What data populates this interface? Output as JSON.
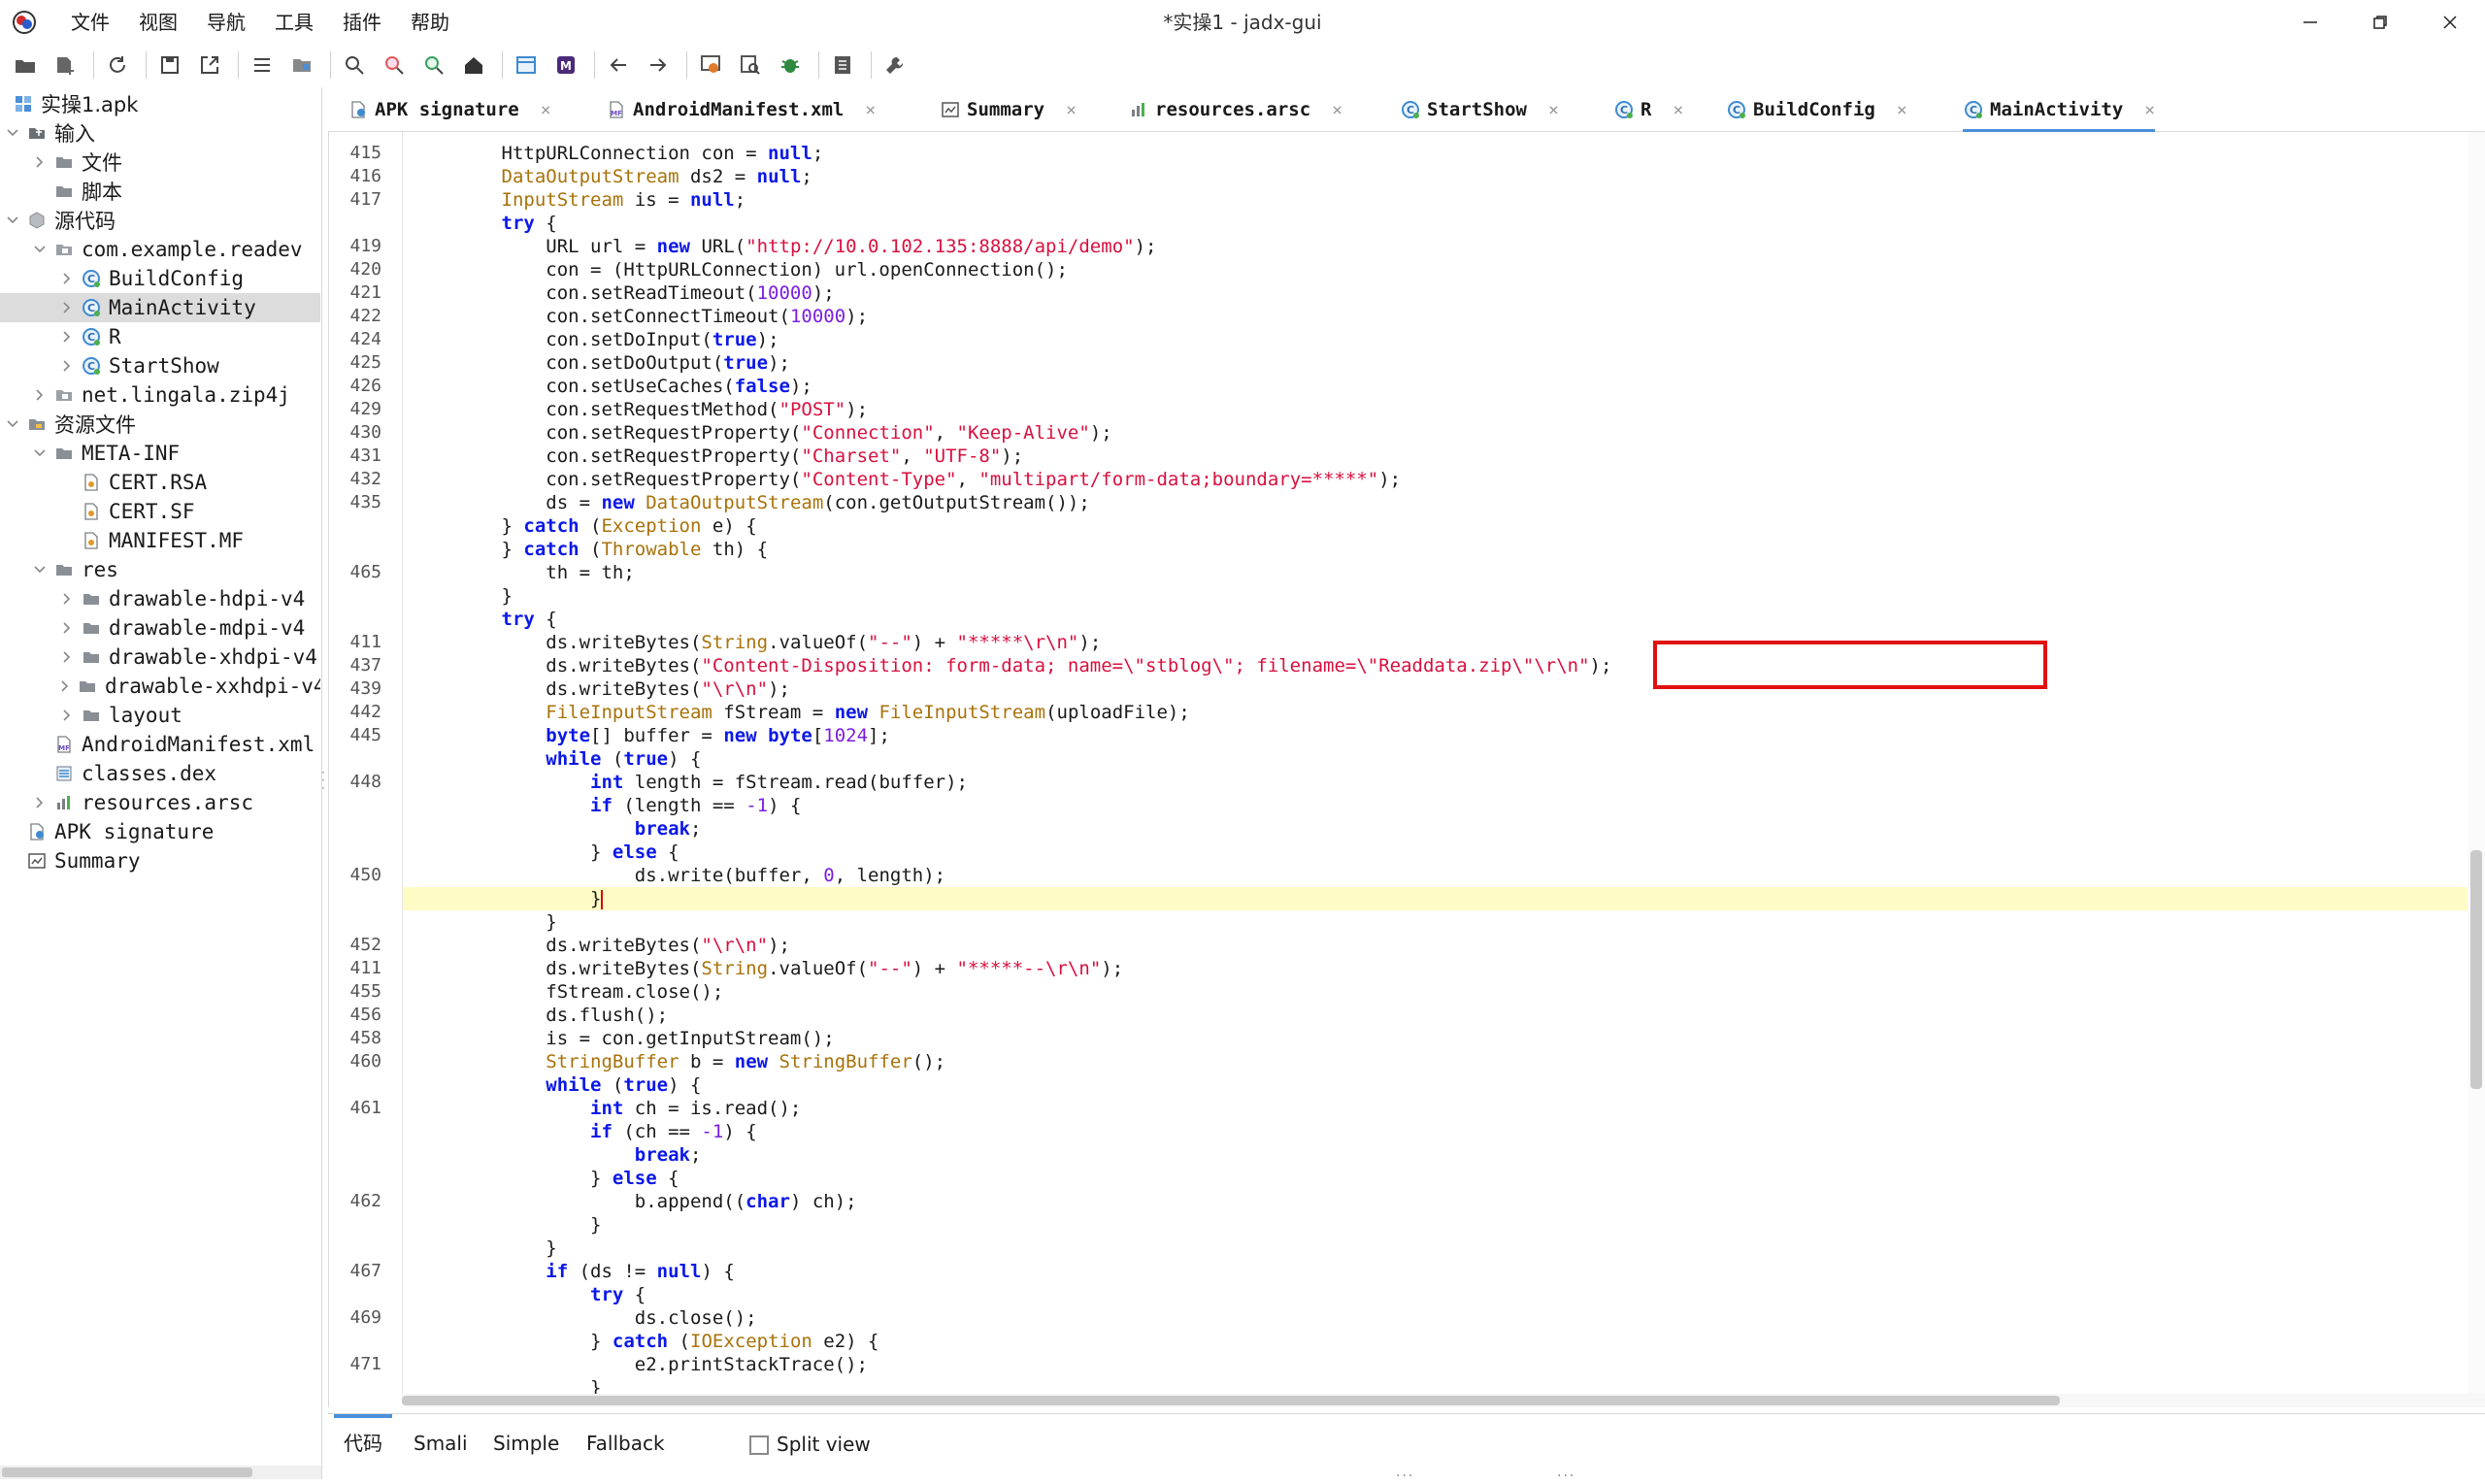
{
  "window": {
    "title": "*实操1 - jadx-gui"
  },
  "menu": [
    "文件",
    "视图",
    "导航",
    "工具",
    "插件",
    "帮助"
  ],
  "toolbar": [
    "open-file-icon",
    "add-files-icon",
    "reload-icon",
    "save-icon",
    "export-icon",
    "sync-icon",
    "flatten-icon",
    "search-icon",
    "find-usage-icon",
    "find-class-icon",
    "home-icon",
    "log-icon",
    "mcp-icon",
    "back-icon",
    "forward-icon",
    "deobfuscation-icon",
    "quark-icon",
    "debug-icon",
    "notes-icon",
    "preferences-icon"
  ],
  "tree": [
    {
      "label": "实操1.apk",
      "icon": "apk-icon",
      "arrow": "",
      "cn": true
    },
    {
      "label": "输入",
      "icon": "input-folder-icon",
      "arrow": "v",
      "cn": true
    },
    {
      "label": "文件",
      "icon": "folder-icon",
      "arrow": ">",
      "cn": true
    },
    {
      "label": "脚本",
      "icon": "folder-icon",
      "arrow": "",
      "cn": true
    },
    {
      "label": "源代码",
      "icon": "source-icon",
      "arrow": "v",
      "cn": true
    },
    {
      "label": "com.example.readev",
      "icon": "package-icon",
      "arrow": "v"
    },
    {
      "label": "BuildConfig",
      "icon": "class-icon",
      "arrow": ">"
    },
    {
      "label": "MainActivity",
      "icon": "class-icon",
      "arrow": ">",
      "selected": true
    },
    {
      "label": "R",
      "icon": "class-icon",
      "arrow": ">"
    },
    {
      "label": "StartShow",
      "icon": "class-icon",
      "arrow": ">"
    },
    {
      "label": "net.lingala.zip4j",
      "icon": "package-icon",
      "arrow": ">"
    },
    {
      "label": "资源文件",
      "icon": "resources-icon",
      "arrow": "v",
      "cn": true
    },
    {
      "label": "META-INF",
      "icon": "folder-icon",
      "arrow": "v"
    },
    {
      "label": "CERT.RSA",
      "icon": "file-icon",
      "arrow": ""
    },
    {
      "label": "CERT.SF",
      "icon": "file-icon",
      "arrow": ""
    },
    {
      "label": "MANIFEST.MF",
      "icon": "file-icon",
      "arrow": ""
    },
    {
      "label": "res",
      "icon": "folder-icon",
      "arrow": "v"
    },
    {
      "label": "drawable-hdpi-v4",
      "icon": "folder-icon",
      "arrow": ">"
    },
    {
      "label": "drawable-mdpi-v4",
      "icon": "folder-icon",
      "arrow": ">"
    },
    {
      "label": "drawable-xhdpi-v4",
      "icon": "folder-icon",
      "arrow": ">"
    },
    {
      "label": "drawable-xxhdpi-v4",
      "icon": "folder-icon",
      "arrow": ">"
    },
    {
      "label": "layout",
      "icon": "folder-icon",
      "arrow": ">"
    },
    {
      "label": "AndroidManifest.xml",
      "icon": "manifest-icon",
      "arrow": ""
    },
    {
      "label": "classes.dex",
      "icon": "dex-icon",
      "arrow": ""
    },
    {
      "label": "resources.arsc",
      "icon": "arsc-icon",
      "arrow": ">"
    },
    {
      "label": "APK signature",
      "icon": "signature-icon",
      "arrow": ""
    },
    {
      "label": "Summary",
      "icon": "summary-icon",
      "arrow": ""
    }
  ],
  "tabs": [
    {
      "label": "APK signature",
      "icon": "signature-icon"
    },
    {
      "label": "AndroidManifest.xml",
      "icon": "manifest-icon"
    },
    {
      "label": "Summary",
      "icon": "summary-icon"
    },
    {
      "label": "resources.arsc",
      "icon": "arsc-icon"
    },
    {
      "label": "StartShow",
      "icon": "class-icon"
    },
    {
      "label": "R",
      "icon": "class-icon"
    },
    {
      "label": "BuildConfig",
      "icon": "class-icon"
    },
    {
      "label": "MainActivity",
      "icon": "class-icon",
      "active": true
    }
  ],
  "code": [
    {
      "ln": "415",
      "segs": [
        [
          "",
          "        HttpURLConnection con = "
        ],
        [
          "kw",
          "null"
        ],
        [
          "",
          ";"
        ]
      ]
    },
    {
      "ln": "416",
      "segs": [
        [
          "typ",
          "        DataOutputStream"
        ],
        [
          "",
          " ds2 = "
        ],
        [
          "kw",
          "null"
        ],
        [
          "",
          ";"
        ]
      ]
    },
    {
      "ln": "417",
      "segs": [
        [
          "typ",
          "        InputStream"
        ],
        [
          "",
          " is = "
        ],
        [
          "kw",
          "null"
        ],
        [
          "",
          ";"
        ]
      ]
    },
    {
      "ln": "",
      "segs": [
        [
          "kw",
          "        try"
        ],
        [
          "",
          " {"
        ]
      ]
    },
    {
      "ln": "419",
      "segs": [
        [
          "",
          "            URL url = "
        ],
        [
          "kw",
          "new"
        ],
        [
          "",
          " URL("
        ],
        [
          "str",
          "\"http://10.0.102.135:8888/api/demo\""
        ],
        [
          "",
          ");"
        ]
      ]
    },
    {
      "ln": "420",
      "segs": [
        [
          "",
          "            con = (HttpURLConnection) url.openConnection();"
        ]
      ]
    },
    {
      "ln": "421",
      "segs": [
        [
          "",
          "            con.setReadTimeout("
        ],
        [
          "num",
          "10000"
        ],
        [
          "",
          ");"
        ]
      ]
    },
    {
      "ln": "422",
      "segs": [
        [
          "",
          "            con.setConnectTimeout("
        ],
        [
          "num",
          "10000"
        ],
        [
          "",
          ");"
        ]
      ]
    },
    {
      "ln": "424",
      "segs": [
        [
          "",
          "            con.setDoInput("
        ],
        [
          "kw",
          "true"
        ],
        [
          "",
          ");"
        ]
      ]
    },
    {
      "ln": "425",
      "segs": [
        [
          "",
          "            con.setDoOutput("
        ],
        [
          "kw",
          "true"
        ],
        [
          "",
          ");"
        ]
      ]
    },
    {
      "ln": "426",
      "segs": [
        [
          "",
          "            con.setUseCaches("
        ],
        [
          "kw",
          "false"
        ],
        [
          "",
          ");"
        ]
      ]
    },
    {
      "ln": "429",
      "segs": [
        [
          "",
          "            con.setRequestMethod("
        ],
        [
          "str",
          "\"POST\""
        ],
        [
          "",
          ");"
        ]
      ]
    },
    {
      "ln": "430",
      "segs": [
        [
          "",
          "            con.setRequestProperty("
        ],
        [
          "str",
          "\"Connection\""
        ],
        [
          "",
          ", "
        ],
        [
          "str",
          "\"Keep-Alive\""
        ],
        [
          "",
          ");"
        ]
      ]
    },
    {
      "ln": "431",
      "segs": [
        [
          "",
          "            con.setRequestProperty("
        ],
        [
          "str",
          "\"Charset\""
        ],
        [
          "",
          ", "
        ],
        [
          "str",
          "\"UTF-8\""
        ],
        [
          "",
          ");"
        ]
      ]
    },
    {
      "ln": "432",
      "segs": [
        [
          "",
          "            con.setRequestProperty("
        ],
        [
          "str",
          "\"Content-Type\""
        ],
        [
          "",
          ", "
        ],
        [
          "str",
          "\"multipart/form-data;boundary=*****\""
        ],
        [
          "",
          ");"
        ]
      ]
    },
    {
      "ln": "435",
      "segs": [
        [
          "",
          "            ds = "
        ],
        [
          "kw",
          "new"
        ],
        [
          "typ",
          " DataOutputStream"
        ],
        [
          "",
          "(con.getOutputStream());"
        ]
      ]
    },
    {
      "ln": "",
      "segs": [
        [
          "",
          "        } "
        ],
        [
          "kw",
          "catch"
        ],
        [
          "",
          " ("
        ],
        [
          "typ",
          "Exception"
        ],
        [
          "",
          " e) {"
        ]
      ]
    },
    {
      "ln": "",
      "segs": [
        [
          "",
          "        } "
        ],
        [
          "kw",
          "catch"
        ],
        [
          "",
          " ("
        ],
        [
          "typ",
          "Throwable"
        ],
        [
          "",
          " th) {"
        ]
      ]
    },
    {
      "ln": "465",
      "segs": [
        [
          "",
          "            th = th;"
        ]
      ]
    },
    {
      "ln": "",
      "segs": [
        [
          "",
          "        }"
        ]
      ]
    },
    {
      "ln": "",
      "segs": [
        [
          "kw",
          "        try"
        ],
        [
          "",
          " {"
        ]
      ]
    },
    {
      "ln": "411",
      "segs": [
        [
          "",
          "            ds.writeBytes("
        ],
        [
          "typ",
          "String"
        ],
        [
          "",
          ".valueOf("
        ],
        [
          "str",
          "\"--\""
        ],
        [
          "",
          ") + "
        ],
        [
          "str",
          "\"*****\\r\\n\""
        ],
        [
          "",
          ");"
        ]
      ]
    },
    {
      "ln": "437",
      "segs": [
        [
          "",
          "            ds.writeBytes("
        ],
        [
          "str",
          "\"Content-Disposition: form-data; name=\\\"stblog\\\"; filename=\\\"Readdata.zip\\\"\\r\\n\""
        ],
        [
          "",
          ");"
        ]
      ]
    },
    {
      "ln": "439",
      "segs": [
        [
          "",
          "            ds.writeBytes("
        ],
        [
          "str",
          "\"\\r\\n\""
        ],
        [
          "",
          ");"
        ]
      ]
    },
    {
      "ln": "442",
      "segs": [
        [
          "typ",
          "            FileInputStream"
        ],
        [
          "",
          " fStream = "
        ],
        [
          "kw",
          "new"
        ],
        [
          "typ",
          " FileInputStream"
        ],
        [
          "",
          "(uploadFile);"
        ]
      ]
    },
    {
      "ln": "445",
      "segs": [
        [
          "kw",
          "            byte"
        ],
        [
          "",
          "[] buffer = "
        ],
        [
          "kw",
          "new byte"
        ],
        [
          "",
          "["
        ],
        [
          "num",
          "1024"
        ],
        [
          "",
          "];"
        ]
      ]
    },
    {
      "ln": "",
      "segs": [
        [
          "kw",
          "            while"
        ],
        [
          "",
          " ("
        ],
        [
          "kw",
          "true"
        ],
        [
          "",
          ") {"
        ]
      ]
    },
    {
      "ln": "448",
      "segs": [
        [
          "kw",
          "                int"
        ],
        [
          "",
          " length = fStream.read(buffer);"
        ]
      ]
    },
    {
      "ln": "",
      "segs": [
        [
          "kw",
          "                if"
        ],
        [
          "",
          " (length == "
        ],
        [
          "num",
          "-1"
        ],
        [
          "",
          ") {"
        ]
      ]
    },
    {
      "ln": "",
      "segs": [
        [
          "kw",
          "                    break"
        ],
        [
          "",
          ";"
        ]
      ]
    },
    {
      "ln": "",
      "segs": [
        [
          "",
          "                } "
        ],
        [
          "kw",
          "else"
        ],
        [
          "",
          " {"
        ]
      ]
    },
    {
      "ln": "450",
      "segs": [
        [
          "",
          "                    ds.write(buffer, "
        ],
        [
          "num",
          "0"
        ],
        [
          "",
          ", length);"
        ]
      ]
    },
    {
      "ln": "",
      "segs": [
        [
          "",
          "                }"
        ]
      ],
      "hl": true,
      "caret": true
    },
    {
      "ln": "",
      "segs": [
        [
          "",
          "            }"
        ]
      ]
    },
    {
      "ln": "452",
      "segs": [
        [
          "",
          "            ds.writeBytes("
        ],
        [
          "str",
          "\"\\r\\n\""
        ],
        [
          "",
          ");"
        ]
      ]
    },
    {
      "ln": "411",
      "segs": [
        [
          "",
          "            ds.writeBytes("
        ],
        [
          "typ",
          "String"
        ],
        [
          "",
          ".valueOf("
        ],
        [
          "str",
          "\"--\""
        ],
        [
          "",
          ") + "
        ],
        [
          "str",
          "\"*****--\\r\\n\""
        ],
        [
          "",
          ");"
        ]
      ]
    },
    {
      "ln": "455",
      "segs": [
        [
          "",
          "            fStream.close();"
        ]
      ]
    },
    {
      "ln": "456",
      "segs": [
        [
          "",
          "            ds.flush();"
        ]
      ]
    },
    {
      "ln": "458",
      "segs": [
        [
          "",
          "            is = con.getInputStream();"
        ]
      ]
    },
    {
      "ln": "460",
      "segs": [
        [
          "typ",
          "            StringBuffer"
        ],
        [
          "",
          " b = "
        ],
        [
          "kw",
          "new"
        ],
        [
          "typ",
          " StringBuffer"
        ],
        [
          "",
          "();"
        ]
      ]
    },
    {
      "ln": "",
      "segs": [
        [
          "kw",
          "            while"
        ],
        [
          "",
          " ("
        ],
        [
          "kw",
          "true"
        ],
        [
          "",
          ") {"
        ]
      ]
    },
    {
      "ln": "461",
      "segs": [
        [
          "kw",
          "                int"
        ],
        [
          "",
          " ch = is.read();"
        ]
      ]
    },
    {
      "ln": "",
      "segs": [
        [
          "kw",
          "                if"
        ],
        [
          "",
          " (ch == "
        ],
        [
          "num",
          "-1"
        ],
        [
          "",
          ") {"
        ]
      ]
    },
    {
      "ln": "",
      "segs": [
        [
          "kw",
          "                    break"
        ],
        [
          "",
          ";"
        ]
      ]
    },
    {
      "ln": "",
      "segs": [
        [
          "",
          "                } "
        ],
        [
          "kw",
          "else"
        ],
        [
          "",
          " {"
        ]
      ]
    },
    {
      "ln": "462",
      "segs": [
        [
          "",
          "                    b.append(("
        ],
        [
          "kw",
          "char"
        ],
        [
          "",
          ") ch);"
        ]
      ]
    },
    {
      "ln": "",
      "segs": [
        [
          "",
          "                }"
        ]
      ]
    },
    {
      "ln": "",
      "segs": [
        [
          "",
          "            }"
        ]
      ]
    },
    {
      "ln": "467",
      "segs": [
        [
          "kw",
          "            if"
        ],
        [
          "",
          " (ds != "
        ],
        [
          "kw",
          "null"
        ],
        [
          "",
          ") {"
        ]
      ]
    },
    {
      "ln": "",
      "segs": [
        [
          "kw",
          "                try"
        ],
        [
          "",
          " {"
        ]
      ]
    },
    {
      "ln": "469",
      "segs": [
        [
          "",
          "                    ds.close();"
        ]
      ]
    },
    {
      "ln": "",
      "segs": [
        [
          "",
          "                } "
        ],
        [
          "kw",
          "catch"
        ],
        [
          "",
          " ("
        ],
        [
          "typ",
          "IOException"
        ],
        [
          "",
          " e2) {"
        ]
      ]
    },
    {
      "ln": "471",
      "segs": [
        [
          "",
          "                    e2.printStackTrace();"
        ]
      ]
    },
    {
      "ln": "",
      "segs": [
        [
          "",
          "                }"
        ]
      ]
    }
  ],
  "bottom": {
    "tabs": [
      "代码",
      "Smali",
      "Simple",
      "Fallback"
    ],
    "split_view": "Split view"
  },
  "colors": {
    "keyword": "#0b18e8",
    "string": "#d8103f",
    "type": "#a8720a",
    "number": "#7a1de0",
    "highlight": "#fffbc4",
    "annotation_box": "#e01010",
    "accent": "#4a8fd8"
  }
}
